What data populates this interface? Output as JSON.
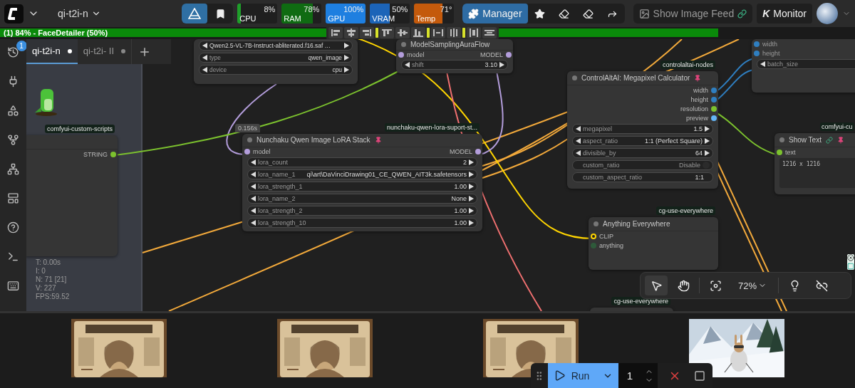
{
  "top_bar": {
    "workflow": "qi-t2i-n",
    "monitors": [
      {
        "label": "CPU",
        "reading": "8%",
        "level": 0.08,
        "color": "#1f9e2a"
      },
      {
        "label": "RAM",
        "reading": "78%",
        "level": 0.78,
        "color": "#0f6b12"
      },
      {
        "label": "GPU",
        "reading": "100%",
        "level": 1,
        "color": "#1e7fe0"
      },
      {
        "label": "VRAM",
        "reading": "50%",
        "level": 0.5,
        "color": "#1c64b8"
      },
      {
        "label": "Temp",
        "reading": "71°",
        "level": 0.71,
        "color": "#c45a0c"
      }
    ],
    "manager": "Manager",
    "image_feed": "Show Image Feed",
    "monitor_logo": "K",
    "monitor": "Monitor"
  },
  "progress": {
    "text": "(1) 84% - FaceDetailer (50%)",
    "level": 0.84
  },
  "sidebar": {
    "badge": "1"
  },
  "tabs": [
    {
      "label": "qi-t2i-n",
      "selected": true
    },
    {
      "label": "qi-t2i- II",
      "selected": false
    }
  ],
  "nodes": [
    {
      "pinned": false,
      "widgets": [
        {
          "kind": "stepper",
          "value": "Qwen2.5-VL-7B-Instruct-abliterated.f16.saf …"
        },
        {
          "kind": "stepper",
          "label": "type",
          "value": "qwen_image"
        },
        {
          "kind": "stepper",
          "label": "device",
          "value": "cpu"
        }
      ]
    },
    {
      "title": "ModelSamplingAuraFlow",
      "pinned": false,
      "inputs": [
        {
          "name": "model",
          "color": "#b39ddb"
        }
      ],
      "outputs": [
        {
          "name": "MODEL",
          "color": "#b39ddb"
        }
      ],
      "widgets": [
        {
          "kind": "stepper",
          "label": "shift",
          "value": "3.10"
        }
      ]
    },
    {
      "pinned": false,
      "inputs": [
        {
          "name": "width",
          "color": "#2f7fc1",
          "disabled": true
        },
        {
          "name": "height",
          "color": "#2f7fc1",
          "disabled": true
        }
      ],
      "widgets": [
        {
          "kind": "stepper",
          "label": "batch_size"
        }
      ]
    },
    {
      "tag": "controlaltai-nodes",
      "title": "ControlAltAI: Megapixel Calculator",
      "pinned": true,
      "outputs": [
        {
          "name": "width",
          "color": "#2f7fc1"
        },
        {
          "name": "height",
          "color": "#2f7fc1"
        },
        {
          "name": "resolution",
          "color": "#7cc22e"
        },
        {
          "name": "preview",
          "color": "#64b5f6"
        }
      ],
      "widgets": [
        {
          "kind": "stepper",
          "label": "megapixel",
          "value": "1.5"
        },
        {
          "kind": "stepper",
          "label": "aspect_ratio",
          "value": "1:1 (Perfect Square)"
        },
        {
          "kind": "stepper",
          "label": "divisible_by",
          "value": "64"
        },
        {
          "kind": "toggle",
          "label": "custom_ratio",
          "value": "Disable",
          "on": false
        },
        {
          "kind": "field",
          "label": "custom_aspect_ratio",
          "value": "1:1"
        }
      ]
    },
    {
      "tag": "comfyui-custom-scripts",
      "pinned": false,
      "outputs": [
        {
          "name": "STRING",
          "color": "#7cc22e"
        }
      ]
    },
    {
      "tag": "nunchaku-qwen-lora-suport-st...",
      "badge": "0.156s",
      "title": "Nunchaku Qwen Image LoRA Stack",
      "pinned": true,
      "inputs": [
        {
          "name": "model",
          "color": "#b39ddb"
        }
      ],
      "outputs": [
        {
          "name": "MODEL",
          "color": "#b39ddb"
        }
      ],
      "widgets": [
        {
          "kind": "stepper",
          "label": "lora_count",
          "value": "2"
        },
        {
          "kind": "stepper",
          "label": "lora_name_1",
          "value": "qi\\art\\DaVinciDrawing01_CE_QWEN_AIT3k.safetensors"
        },
        {
          "kind": "stepper",
          "label": "lora_strength_1",
          "value": "1.00"
        },
        {
          "kind": "stepper",
          "label": "lora_name_2",
          "value": "None"
        },
        {
          "kind": "stepper",
          "label": "lora_strength_2",
          "value": "1.00"
        },
        {
          "kind": "stepper",
          "label": "lora_strength_10",
          "value": "1.00"
        }
      ]
    },
    {
      "tag": "comfyui-cu",
      "title": "Show Text",
      "pinned": true,
      "inputs": [
        {
          "name": "text",
          "color": "#7cc22e"
        }
      ],
      "widgets": [
        {
          "kind": "textarea",
          "value": "1216 x 1216"
        }
      ]
    },
    {
      "tag": "cg-use-everywhere",
      "title": "Anything Everywhere",
      "pinned": false,
      "inputs": [
        {
          "name": "CLIP",
          "color": "#ffd500"
        },
        {
          "name": "anything",
          "color": "#2e5a3a"
        }
      ]
    },
    {
      "tag": "cg-use-everywhere"
    }
  ],
  "stats": [
    "T: 0.00s",
    "I: 0",
    "N: 71 [21]",
    "V: 227",
    "FPS:59.52"
  ],
  "canvas_toolbar": {
    "zoom": "72%"
  },
  "gallery": [
    {
      "kind": "picture"
    },
    {
      "kind": "picture"
    },
    {
      "kind": "picture"
    },
    {
      "kind": "picture"
    }
  ],
  "run_bar": {
    "label": "Run",
    "count": "1"
  }
}
